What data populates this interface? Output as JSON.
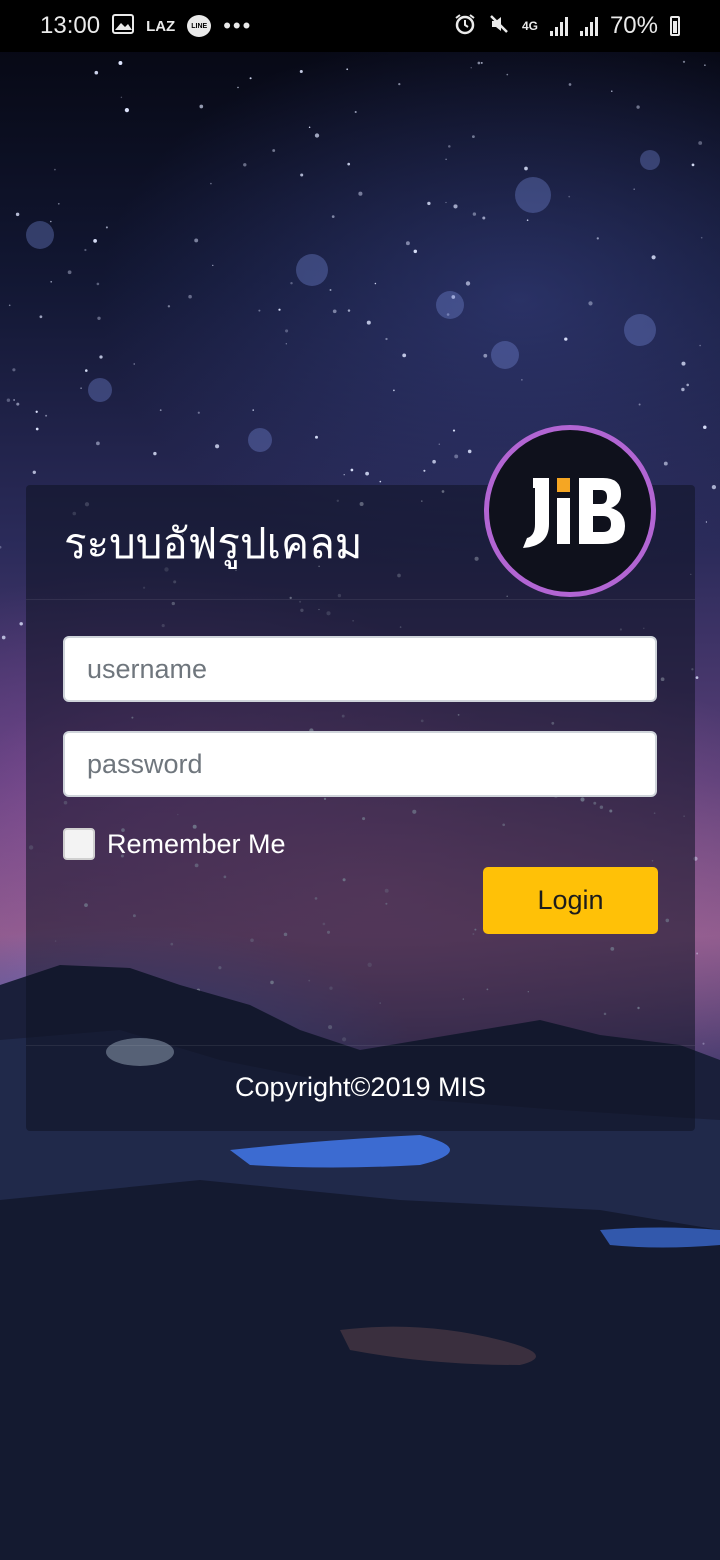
{
  "status_bar": {
    "time": "13:00",
    "notification_icons": [
      "image-icon",
      "laz-icon",
      "line-icon"
    ],
    "laz_label": "LAZ",
    "line_label": "LINE",
    "more": "•••",
    "network_label": "4G",
    "battery_percent": "70%"
  },
  "login": {
    "title": "ระบบอัฟรูปเคลม",
    "logo_text": "JIB",
    "username_placeholder": "username",
    "password_placeholder": "password",
    "remember_label": "Remember Me",
    "remember_checked": false,
    "login_label": "Login",
    "copyright": "Copyright©2019 MIS"
  },
  "colors": {
    "accent": "#ffc107",
    "logo_ring": "#b265d3",
    "logo_accent": "#f5a623"
  }
}
